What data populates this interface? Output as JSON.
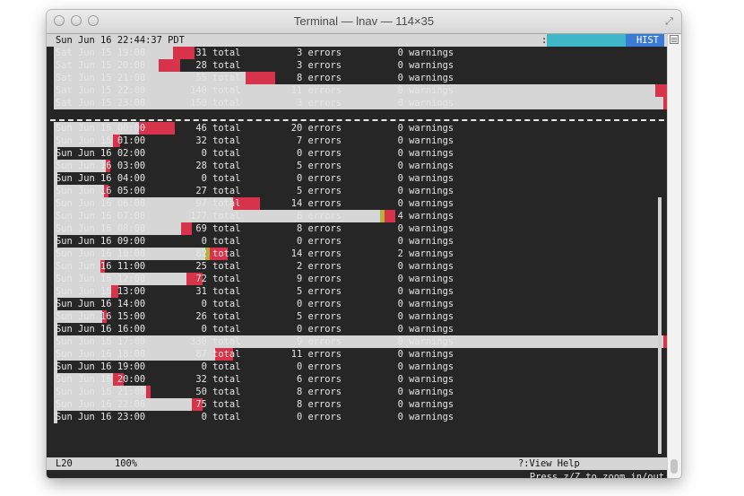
{
  "window": {
    "title": "Terminal — lnav — 114×35"
  },
  "colors": {
    "bg": "#262626",
    "fg": "#e6e6e6",
    "total": "#d6d6d6",
    "error": "#d7344b",
    "warning": "#b4b23c",
    "hist_teal": "#3fb7c8",
    "hist_blue": "#3a7bd5"
  },
  "header": {
    "datetime": "Sun Jun 16 22:44:37 PDT",
    "colon": ":",
    "hist_label": "HIST"
  },
  "rows_top": [
    {
      "label": "Sat Jun 15 19:00",
      "total": "31",
      "errors": "3",
      "warnings": "0",
      "total_frac": 0.196,
      "err_frac": 0.036,
      "warn_frac": 0
    },
    {
      "label": "Sat Jun 15 20:00",
      "total": "28",
      "errors": "3",
      "warnings": "0",
      "total_frac": 0.172,
      "err_frac": 0.036,
      "warn_frac": 0
    },
    {
      "label": "Sat Jun 15 21:00",
      "total": "55",
      "errors": "8",
      "warnings": "0",
      "total_frac": 0.314,
      "err_frac": 0.048,
      "warn_frac": 0
    },
    {
      "label": "Sat Jun 15 22:00",
      "total": "140",
      "errors": "11",
      "warnings": "0",
      "total_frac": 0.987,
      "err_frac": 0.105,
      "warn_frac": 0
    },
    {
      "label": "Sat Jun 15 23:00",
      "total": "150",
      "errors": "3",
      "warnings": "0",
      "total_frac": 1.0,
      "err_frac": 0.02,
      "warn_frac": 0
    }
  ],
  "rows_bottom": [
    {
      "label": "Sun Jun 16 00:00",
      "total": "46",
      "errors": "20",
      "warnings": "0",
      "total_frac": 0.139,
      "err_frac": 0.059,
      "warn_frac": 0
    },
    {
      "label": "Sun Jun 16 01:00",
      "total": "32",
      "errors": "7",
      "warnings": "0",
      "total_frac": 0.097,
      "err_frac": 0.012,
      "warn_frac": 0
    },
    {
      "label": "Sun Jun 16 02:00",
      "total": "0",
      "errors": "0",
      "warnings": "0",
      "total_frac": 0.004,
      "err_frac": 0,
      "warn_frac": 0
    },
    {
      "label": "Sun Jun 16 03:00",
      "total": "28",
      "errors": "5",
      "warnings": "0",
      "total_frac": 0.085,
      "err_frac": 0.008,
      "warn_frac": 0
    },
    {
      "label": "Sun Jun 16 04:00",
      "total": "0",
      "errors": "0",
      "warnings": "0",
      "total_frac": 0.004,
      "err_frac": 0,
      "warn_frac": 0
    },
    {
      "label": "Sun Jun 16 05:00",
      "total": "27",
      "errors": "5",
      "warnings": "0",
      "total_frac": 0.082,
      "err_frac": 0.008,
      "warn_frac": 0
    },
    {
      "label": "Sun Jun 16 06:00",
      "total": "97",
      "errors": "14",
      "warnings": "0",
      "total_frac": 0.294,
      "err_frac": 0.044,
      "warn_frac": 0
    },
    {
      "label": "Sun Jun 16 07:00",
      "total": "177",
      "errors": "8",
      "warnings": "4",
      "total_frac": 0.536,
      "err_frac": 0.018,
      "warn_frac": 0.008
    },
    {
      "label": "Sun Jun 16 08:00",
      "total": "69",
      "errors": "8",
      "warnings": "0",
      "total_frac": 0.209,
      "err_frac": 0.018,
      "warn_frac": 0
    },
    {
      "label": "Sun Jun 16 09:00",
      "total": "0",
      "errors": "0",
      "warnings": "0",
      "total_frac": 0.004,
      "err_frac": 0,
      "warn_frac": 0
    },
    {
      "label": "Sun Jun 16 10:00",
      "total": "82",
      "errors": "14",
      "warnings": "2",
      "total_frac": 0.248,
      "err_frac": 0.03,
      "warn_frac": 0.008
    },
    {
      "label": "Sun Jun 16 11:00",
      "total": "25",
      "errors": "2",
      "warnings": "0",
      "total_frac": 0.076,
      "err_frac": 0.008,
      "warn_frac": 0
    },
    {
      "label": "Sun Jun 16 12:00",
      "total": "72",
      "errors": "9",
      "warnings": "0",
      "total_frac": 0.218,
      "err_frac": 0.026,
      "warn_frac": 0
    },
    {
      "label": "Sun Jun 16 13:00",
      "total": "31",
      "errors": "5",
      "warnings": "0",
      "total_frac": 0.094,
      "err_frac": 0.012,
      "warn_frac": 0
    },
    {
      "label": "Sun Jun 16 14:00",
      "total": "0",
      "errors": "0",
      "warnings": "0",
      "total_frac": 0.004,
      "err_frac": 0,
      "warn_frac": 0
    },
    {
      "label": "Sun Jun 16 15:00",
      "total": "26",
      "errors": "5",
      "warnings": "0",
      "total_frac": 0.079,
      "err_frac": 0.008,
      "warn_frac": 0
    },
    {
      "label": "Sun Jun 16 16:00",
      "total": "0",
      "errors": "0",
      "warnings": "0",
      "total_frac": 0.004,
      "err_frac": 0,
      "warn_frac": 0
    },
    {
      "label": "Sun Jun 16 17:00",
      "total": "330",
      "errors": "9",
      "warnings": "0",
      "total_frac": 1.0,
      "err_frac": 0.028,
      "warn_frac": 0
    },
    {
      "label": "Sun Jun 16 18:00",
      "total": "87",
      "errors": "11",
      "warnings": "0",
      "total_frac": 0.264,
      "err_frac": 0.03,
      "warn_frac": 0
    },
    {
      "label": "Sun Jun 16 19:00",
      "total": "0",
      "errors": "0",
      "warnings": "0",
      "total_frac": 0.004,
      "err_frac": 0,
      "warn_frac": 0
    },
    {
      "label": "Sun Jun 16 20:00",
      "total": "32",
      "errors": "6",
      "warnings": "0",
      "total_frac": 0.097,
      "err_frac": 0.018,
      "warn_frac": 0
    },
    {
      "label": "Sun Jun 16 21:00",
      "total": "50",
      "errors": "8",
      "warnings": "0",
      "total_frac": 0.152,
      "err_frac": 0.008,
      "warn_frac": 0
    },
    {
      "label": "Sun Jun 16 22:00",
      "total": "75",
      "errors": "8",
      "warnings": "0",
      "total_frac": 0.227,
      "err_frac": 0.018,
      "warn_frac": 0
    },
    {
      "label": "Sun Jun 16 23:00",
      "total": "0",
      "errors": "0",
      "warnings": "0",
      "total_frac": 0.004,
      "err_frac": 0,
      "warn_frac": 0
    }
  ],
  "words": {
    "total": "total",
    "errors": "errors",
    "warnings": "warnings"
  },
  "status": {
    "line": "L20",
    "percent": "100%",
    "help": "?:View Help"
  },
  "footer": {
    "hint": "Press z/Z to zoom in/out"
  }
}
